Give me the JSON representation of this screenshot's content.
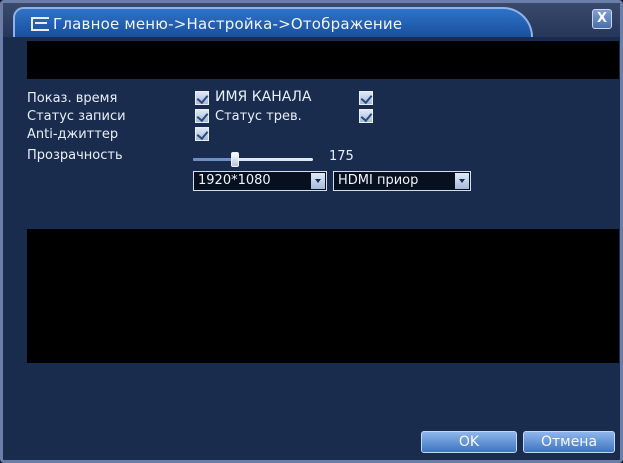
{
  "window": {
    "title": "Главное меню->Настройка->Отображение",
    "close_label": "X"
  },
  "settings": {
    "show_time_label": "Показ. время",
    "channel_name_label": "ИМЯ КАНАЛА",
    "record_status_label": "Статус записи",
    "alarm_status_label": "Статус трев.",
    "anti_jitter_label": "Anti-джиттер",
    "transparency_label": "Прозрачность",
    "transparency_value": "175",
    "transparency_fraction": 0.35,
    "show_time_checked": true,
    "channel_name_checked": true,
    "record_status_checked": true,
    "alarm_status_checked": true,
    "anti_jitter_checked": true,
    "resolution_value": "1920*1080",
    "output_value": "HDMI приор"
  },
  "buttons": {
    "ok_label": "OK",
    "cancel_label": "Отмена"
  },
  "colors": {
    "panel": "#1a2c4e",
    "title_bar": "#2e73c8",
    "button": "#3e74c4",
    "video_area": "#000000"
  }
}
